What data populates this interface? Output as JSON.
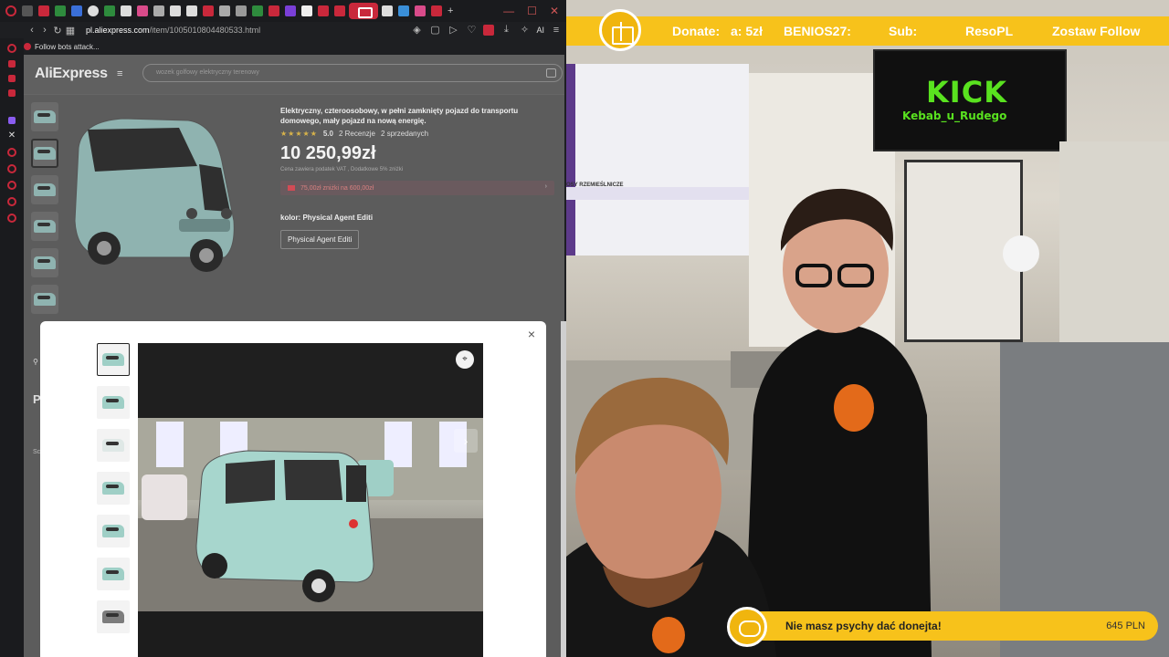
{
  "browser": {
    "url_host": "pl.aliexpress.com",
    "url_path": "/item/1005010804480533.html",
    "ai_badge": "AI",
    "bookmark_label": "Follow bots attack...",
    "window_controls": [
      "—",
      "☐",
      "✕"
    ]
  },
  "aliexpress": {
    "logo": "AliExpress",
    "search_placeholder": "wozek golfowy elektryczny terenowy",
    "product_title": "Elektryczny, czteroosobowy, w pełni zamknięty pojazd do transportu domowego, mały pojazd na nową energię.",
    "rating_value": "5.0",
    "reviews": "2 Recenzje",
    "sold": "2 sprzedanych",
    "stars": "★★★★★",
    "price": "10 250,99zł",
    "tax_note": "Cena zawiera podatek VAT , Dodatkowe 5% zniżki",
    "coupon": "75,00zł zniżki na 600,00zł",
    "color_label": "kolor: Physical Agent Editi",
    "variant": "Physical Agent Editi",
    "left_fragment_2": "P",
    "left_fragment_3": "Sc"
  },
  "modal": {
    "close": "×",
    "scan_icon": "⌖",
    "next": "›"
  },
  "stream": {
    "donate_label": "Donate:",
    "donate_value": "a: 5zł",
    "donate_user": "BENIOS27:",
    "sub_label": "Sub:",
    "sub_user": "ResoPL",
    "follow_label": "Zostaw Follow",
    "tv_title": "KICK",
    "tv_subtitle": "Kebab_u_Rudego",
    "menu_section": "OSY RZEMIEŚLNICZE",
    "goal_text": "Nie masz psychy dać donejta!",
    "goal_amount": "645 PLN"
  }
}
